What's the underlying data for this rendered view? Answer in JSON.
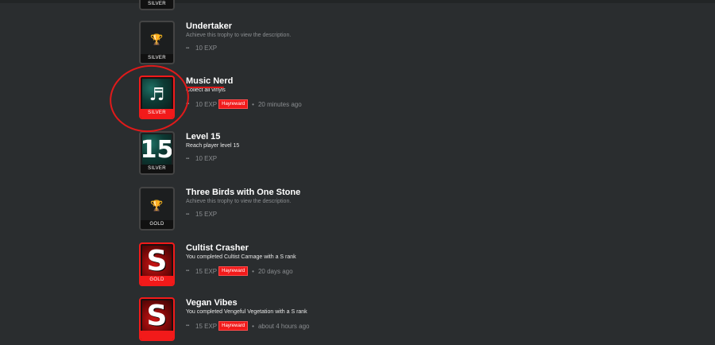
{
  "trophies": [
    {
      "id": "silver-top",
      "title": "",
      "tier": "SILVER"
    },
    {
      "id": "undertaker",
      "title": "Undertaker",
      "description": "Achieve this trophy to view the description.",
      "exp": "10 EXP",
      "tier": "SILVER",
      "icon": "trophy-icon",
      "hidden": true
    },
    {
      "id": "music-nerd",
      "title": "Music Nerd",
      "description": "Collect all vinyls",
      "exp": "10 EXP",
      "badge": "Hayreward",
      "time": "20 minutes ago",
      "tier": "SILVER",
      "icon": "music-notes-icon"
    },
    {
      "id": "level-15",
      "title": "Level 15",
      "description": "Reach player level 15",
      "exp": "10 EXP",
      "tier": "SILVER",
      "art_text": "15"
    },
    {
      "id": "three-birds",
      "title": "Three Birds with One Stone",
      "description": "Achieve this trophy to view the description.",
      "exp": "15 EXP",
      "tier": "GOLD",
      "icon": "trophy-icon",
      "hidden": true
    },
    {
      "id": "cultist-crasher",
      "title": "Cultist Crasher",
      "description": "You completed Cultist Carnage with a S rank",
      "exp": "15 EXP",
      "badge": "Hayreward",
      "time": "20 days ago",
      "tier": "GOLD",
      "art_text": "S"
    },
    {
      "id": "vegan-vibes",
      "title": "Vegan Vibes",
      "description": "You completed Vengeful Vegetation with a S rank",
      "exp": "15 EXP",
      "badge": "Hayreward",
      "time": "about 4 hours ago",
      "tier": "",
      "art_text": "S"
    }
  ],
  "colors": {
    "accent_red": "#f21a1a",
    "background": "#2a2d2f",
    "muted_text": "#8a8d90"
  }
}
